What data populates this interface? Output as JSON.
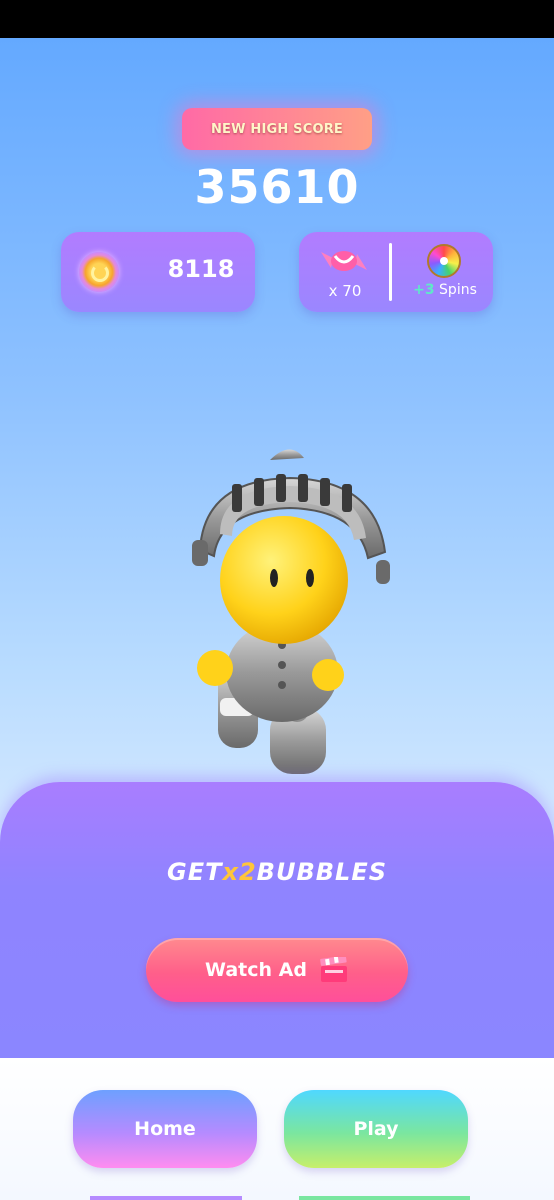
{
  "header": {
    "badge_label": "NEW HIGH SCORE",
    "score": "35610"
  },
  "stats": {
    "coins": "8118",
    "candy_count": "x 70",
    "spins_bonus": "+3",
    "spins_label": "Spins"
  },
  "promo": {
    "prefix": "GET",
    "multiplier": "x2",
    "suffix": "BUBBLES",
    "watch_label": "Watch Ad"
  },
  "nav": {
    "home_label": "Home",
    "play_label": "Play"
  },
  "colors": {
    "sky_top": "#64a9ff",
    "card": "#8f84ff",
    "watch_button": "#ff5f8a",
    "multiplier_accent": "#ffc53a",
    "spins_accent": "#5fe8c8"
  },
  "icons": [
    "coin-icon",
    "candy-icon",
    "prize-wheel-icon",
    "clapperboard-icon"
  ]
}
